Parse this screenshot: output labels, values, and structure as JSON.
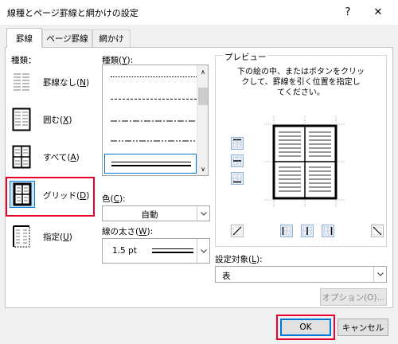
{
  "window": {
    "title": "線種とページ罫線と網かけの設定",
    "help_glyph": "?",
    "close_glyph": "✕"
  },
  "tabs": [
    {
      "label": "罫線"
    },
    {
      "label": "ページ罫線"
    },
    {
      "label": "網かけ"
    }
  ],
  "settings": {
    "label": "種類：",
    "items": [
      {
        "label": "罫線なし",
        "key": "N"
      },
      {
        "label": "囲む",
        "key": "X"
      },
      {
        "label": "すべて",
        "key": "A"
      },
      {
        "label": "グリッド",
        "key": "D"
      },
      {
        "label": "指定",
        "key": "U"
      }
    ]
  },
  "style": {
    "label": "種類",
    "key": "Y"
  },
  "color": {
    "label": "色",
    "key": "C",
    "value": "自動"
  },
  "width": {
    "label": "線の太さ",
    "key": "W",
    "value": "1.5 pt"
  },
  "preview": {
    "label": "プレビュー",
    "instruction_1": "下の絵の中、またはボタンをクリッ",
    "instruction_2": "クして、罫線を引く位置を指定し",
    "instruction_3": "てください。"
  },
  "apply_to": {
    "label": "設定対象",
    "key": "L",
    "value": "表"
  },
  "buttons": {
    "options": "オプション(O)...",
    "ok": "OK",
    "cancel": "キャンセル"
  },
  "colors": {
    "accent": "#0078d7",
    "highlight": "#e8002a"
  }
}
